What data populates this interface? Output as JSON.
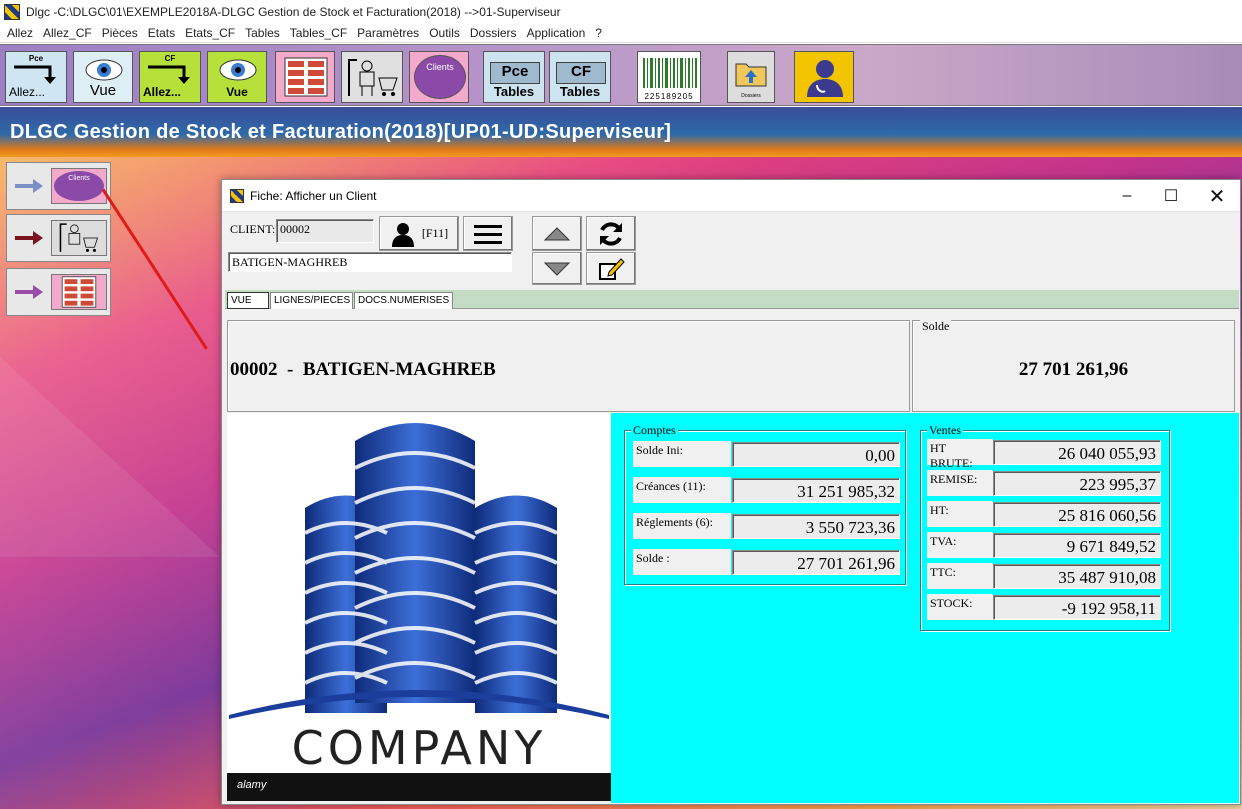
{
  "window": {
    "title": "Dlgc -C:\\DLGC\\01\\EXEMPLE2018A-DLGC Gestion de Stock et Facturation(2018) -->01-Superviseur"
  },
  "menu": [
    "Allez",
    "Allez_CF",
    "Pièces",
    "Etats",
    "Etats_CF",
    "Tables",
    "Tables_CF",
    "Paramètres",
    "Outils",
    "Dossiers",
    "Application",
    "?"
  ],
  "toolbar": {
    "allez_pce_sub": "Pce",
    "allez_pce": "Allez...",
    "vue": "Vue",
    "allez_cf_sub": "CF",
    "allez_cf": "Allez...",
    "vue2": "Vue",
    "clients": "Clients",
    "pce_tables_top": "Pce",
    "pce_tables": "Tables",
    "cf_tables_top": "CF",
    "cf_tables": "Tables",
    "barcode_number": "225189205",
    "dossiers": "Dossiers"
  },
  "band": {
    "title": "DLGC Gestion de Stock et Facturation(2018)[UP01-UD:Superviseur]"
  },
  "side": {
    "clients_label": "Clients"
  },
  "dialog": {
    "title": "Fiche: Afficher un Client",
    "client_label": "CLIENT:",
    "client_code": "00002",
    "f11": "[F11]",
    "client_name": "BATIGEN-MAGHREB",
    "tabs": [
      "VUE",
      "LIGNES/PIECES",
      "DOCS.NUMERISES"
    ],
    "header_line": "00002  -  BATIGEN-MAGHREB",
    "solde_legend": "Solde",
    "solde_value": "27 701 261,96",
    "logo_text": "COMPANY",
    "logo_footer": "alamy",
    "comptes": {
      "legend": "Comptes",
      "rows": [
        {
          "label": "Solde Ini:",
          "value": "0,00"
        },
        {
          "label": "Créances (11):",
          "value": "31 251 985,32"
        },
        {
          "label": "Réglements (6):",
          "value": "3 550 723,36"
        },
        {
          "label": "Solde :",
          "value": "27 701 261,96"
        }
      ]
    },
    "ventes": {
      "legend": "Ventes",
      "rows": [
        {
          "label": "HT BRUTE:",
          "value": "26 040 055,93"
        },
        {
          "label": "REMISE:",
          "value": "223 995,37"
        },
        {
          "label": "HT:",
          "value": "25 816 060,56"
        },
        {
          "label": "TVA:",
          "value": "9 671 849,52"
        },
        {
          "label": "TTC:",
          "value": "35 487 910,08"
        },
        {
          "label": "STOCK:",
          "value": "-9 192 958,11"
        }
      ]
    }
  }
}
